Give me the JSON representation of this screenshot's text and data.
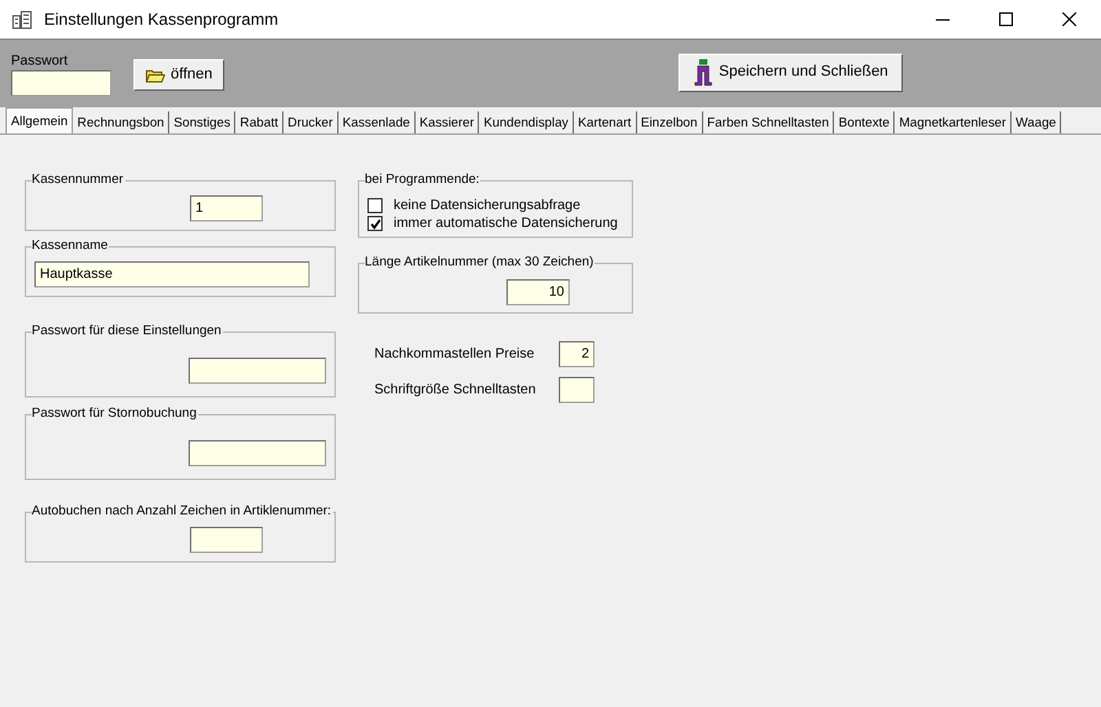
{
  "window": {
    "title": "Einstellungen Kassenprogramm"
  },
  "toolbar": {
    "password_label": "Passwort",
    "open_button": "öffnen",
    "save_button": "Speichern und  Schließen"
  },
  "tabs": [
    {
      "label": "Allgemein",
      "selected": true
    },
    {
      "label": "Rechnungsbon",
      "selected": false
    },
    {
      "label": "Sonstiges",
      "selected": false
    },
    {
      "label": "Rabatt",
      "selected": false
    },
    {
      "label": "Drucker",
      "selected": false
    },
    {
      "label": "Kassenlade",
      "selected": false
    },
    {
      "label": "Kassierer",
      "selected": false
    },
    {
      "label": "Kundendisplay",
      "selected": false
    },
    {
      "label": "Kartenart",
      "selected": false
    },
    {
      "label": "Einzelbon",
      "selected": false
    },
    {
      "label": "Farben Schnelltasten",
      "selected": false
    },
    {
      "label": "Bontexte",
      "selected": false
    },
    {
      "label": "Magnetkartenleser",
      "selected": false
    },
    {
      "label": "Waage",
      "selected": false
    }
  ],
  "left_groups": [
    {
      "label": "Kassennummer",
      "value": "1"
    },
    {
      "label": "Kassenname",
      "value": "Hauptkasse"
    },
    {
      "label": "Passwort für diese Einstellungen"
    },
    {
      "label": "Passwort für Stornobuchung"
    },
    {
      "label": "Autobuchen nach Anzahl Zeichen in Artiklenummer:"
    }
  ],
  "program_end": {
    "label": "bei Programmende:",
    "options": [
      {
        "label": "keine Datensicherungsabfrage",
        "checked": false
      },
      {
        "label": "immer automatische Datensicherung",
        "checked": true
      }
    ]
  },
  "article_length": {
    "label": "Länge Artikelnummer (max 30 Zeichen)",
    "value": "10"
  },
  "fields": [
    {
      "label": "Nachkommastellen Preise",
      "value": "2"
    },
    {
      "label": "Schriftgröße Schnelltasten"
    }
  ]
}
